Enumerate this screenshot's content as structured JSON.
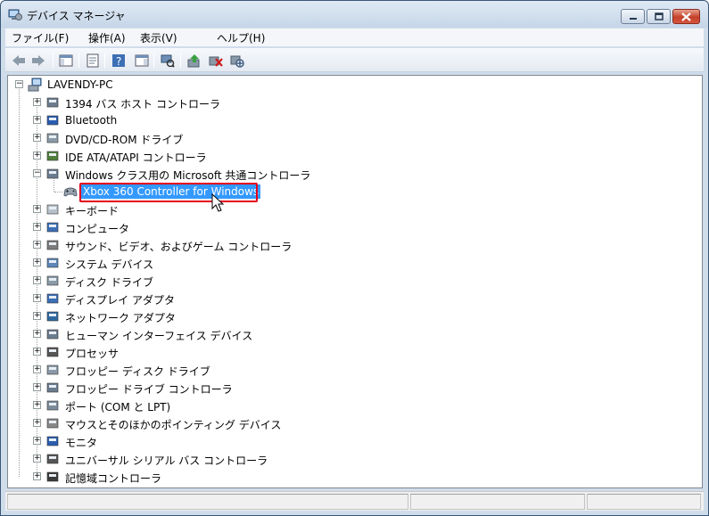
{
  "window": {
    "title": "デバイス マネージャ"
  },
  "menu": [
    "ファイル(F)",
    "操作(A)",
    "表示(V)",
    "ヘルプ(H)"
  ],
  "toolbar": [
    {
      "name": "back-icon"
    },
    {
      "name": "forward-icon"
    },
    {
      "name": "show-hide-console-tree-icon"
    },
    {
      "name": "properties-icon"
    },
    {
      "name": "help-icon"
    },
    {
      "name": "show-action-pane-icon"
    },
    {
      "name": "scan-hardware-icon"
    },
    {
      "name": "update-driver-icon"
    },
    {
      "name": "uninstall-icon"
    },
    {
      "name": "disable-icon"
    }
  ],
  "tree": {
    "root": "LAVENDY-PC",
    "categories": [
      "1394 バス ホスト コントローラ",
      "Bluetooth",
      "DVD/CD-ROM ドライブ",
      "IDE ATA/ATAPI コントローラ",
      "Windows クラス用の Microsoft 共通コントローラ",
      "キーボード",
      "コンピュータ",
      "サウンド、ビデオ、およびゲーム コントローラ",
      "システム デバイス",
      "ディスク ドライブ",
      "ディスプレイ アダプタ",
      "ネットワーク アダプタ",
      "ヒューマン インターフェイス デバイス",
      "プロセッサ",
      "フロッピー ディスク ドライブ",
      "フロッピー ドライブ コントローラ",
      "ポート (COM と LPT)",
      "マウスとそのほかのポインティング デバイス",
      "モニタ",
      "ユニバーサル シリアル バス コントローラ",
      "記憶域コントローラ"
    ],
    "selected_child": "Xbox 360 Controller for Windows"
  },
  "colors": {
    "highlight": "#3399ff",
    "annotation": "#e3001b"
  }
}
